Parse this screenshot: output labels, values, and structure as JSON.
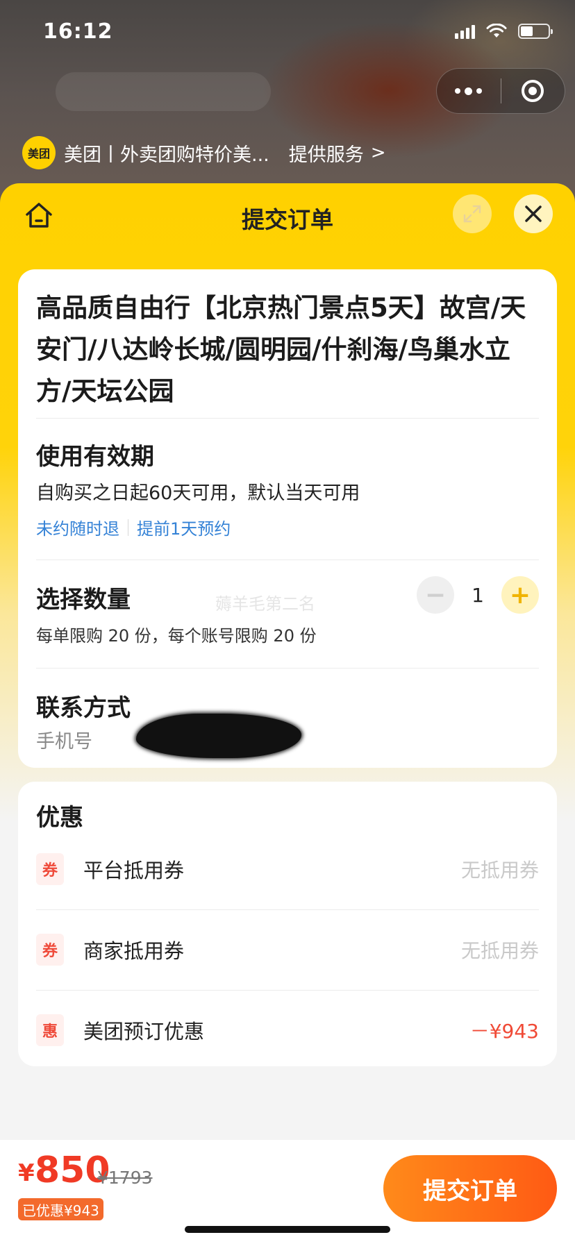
{
  "status_bar": {
    "time": "16:12"
  },
  "mini_program_bar": {
    "logo_text": "美团",
    "title": "美团丨外卖团购特价美...",
    "service_label": "提供服务",
    "chevron": ">"
  },
  "sheet": {
    "title": "提交订单",
    "icons": {
      "home": "home-icon",
      "expand": "expand-icon",
      "close": "close-icon"
    }
  },
  "product": {
    "title": "高品质自由行【北京热门景点5天】故宫/天安门/八达岭长城/圆明园/什刹海/鸟巢水立方/天坛公园"
  },
  "validity": {
    "heading": "使用有效期",
    "text": "自购买之日起60天可用，默认当天可用",
    "tags": [
      "未约随时退",
      "提前1天预约"
    ]
  },
  "quantity": {
    "heading": "选择数量",
    "minus": "−",
    "value": "1",
    "plus": "+",
    "limit_text": "每单限购 20 份，每个账号限购 20 份",
    "watermark": "薅羊毛第二名"
  },
  "contact": {
    "heading": "联系方式",
    "phone_label": "手机号"
  },
  "promotions": {
    "heading": "优惠",
    "rows": [
      {
        "badge": "券",
        "label": "平台抵用券",
        "value": "无抵用券"
      },
      {
        "badge": "券",
        "label": "商家抵用券",
        "value": "无抵用券"
      },
      {
        "badge": "惠",
        "label": "美团预订优惠",
        "value": "－¥943"
      }
    ]
  },
  "checkout": {
    "currency": "¥",
    "price": "850",
    "original_price": "¥1793",
    "saved_label": "已优惠¥943",
    "submit_label": "提交订单"
  },
  "colors": {
    "brand_yellow": "#ffd100",
    "price_red": "#f03a25",
    "link_blue": "#3482d6",
    "submit_orange": "#ff6a18"
  }
}
